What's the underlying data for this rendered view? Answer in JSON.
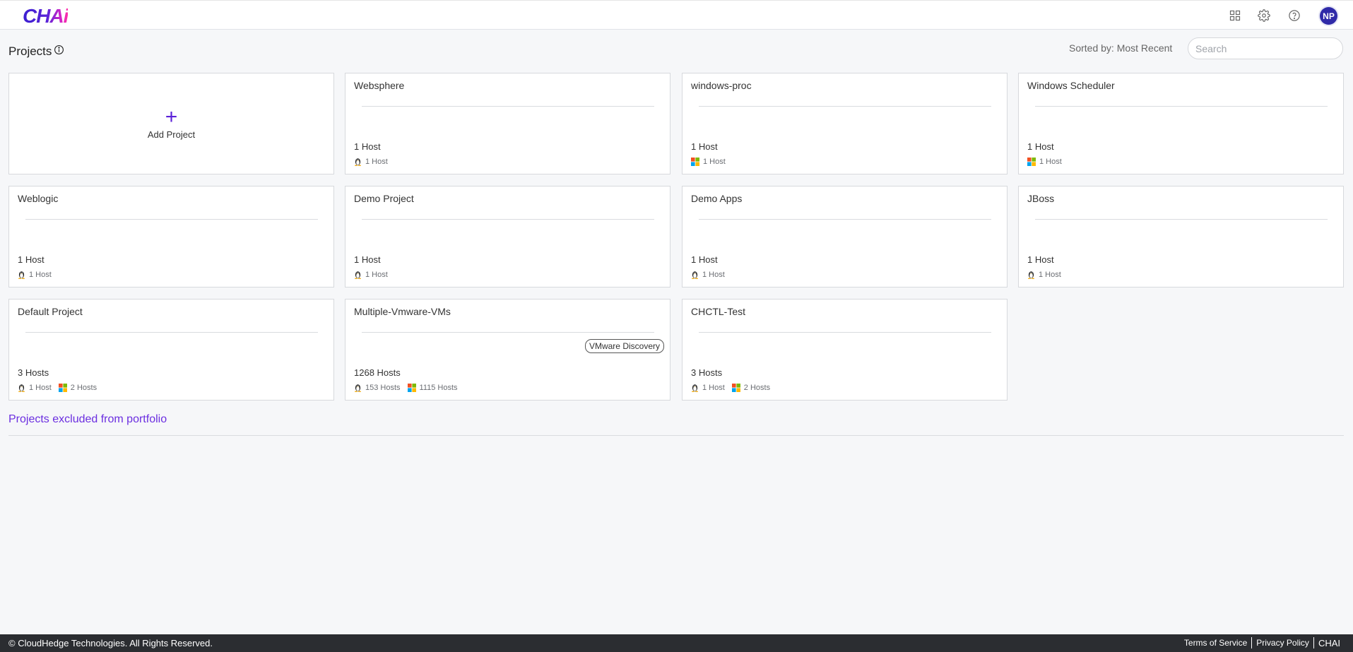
{
  "header": {
    "logo": "CHAi",
    "user_initials": "NP"
  },
  "page": {
    "title": "Projects",
    "sorted_by": "Sorted by: Most Recent",
    "search_placeholder": "Search"
  },
  "add_project_label": "Add Project",
  "projects": [
    {
      "name": "Websphere",
      "hosts": "1 Host",
      "os": [
        {
          "type": "linux-icon",
          "label": "1 Host"
        }
      ]
    },
    {
      "name": "windows-proc",
      "hosts": "1 Host",
      "os": [
        {
          "type": "windows-icon",
          "label": "1 Host"
        }
      ]
    },
    {
      "name": "Windows Scheduler",
      "hosts": "1 Host",
      "os": [
        {
          "type": "windows-icon",
          "label": "1 Host"
        }
      ]
    },
    {
      "name": "Weblogic",
      "hosts": "1 Host",
      "os": [
        {
          "type": "linux-icon",
          "label": "1 Host"
        }
      ]
    },
    {
      "name": "Demo Project",
      "hosts": "1 Host",
      "os": [
        {
          "type": "linux-icon",
          "label": "1 Host"
        }
      ]
    },
    {
      "name": "Demo Apps",
      "hosts": "1 Host",
      "os": [
        {
          "type": "linux-icon",
          "label": "1 Host"
        }
      ]
    },
    {
      "name": "JBoss",
      "hosts": "1 Host",
      "os": [
        {
          "type": "linux-icon",
          "label": "1 Host"
        }
      ]
    },
    {
      "name": "Default Project",
      "hosts": "3 Hosts",
      "os": [
        {
          "type": "linux-icon",
          "label": "1 Host"
        },
        {
          "type": "windows-icon",
          "label": "2 Hosts"
        }
      ]
    },
    {
      "name": "Multiple-Vmware-VMs",
      "hosts": "1268 Hosts",
      "badge": "VMware Discovery",
      "os": [
        {
          "type": "linux-icon",
          "label": "153 Hosts"
        },
        {
          "type": "windows-icon",
          "label": "1115 Hosts"
        }
      ]
    },
    {
      "name": "CHCTL-Test",
      "hosts": "3 Hosts",
      "os": [
        {
          "type": "linux-icon",
          "label": "1 Host"
        },
        {
          "type": "windows-icon",
          "label": "2 Hosts"
        }
      ]
    }
  ],
  "excluded_link": "Projects excluded from portfolio",
  "footer": {
    "copyright": "© CloudHedge Technologies. All Rights Reserved.",
    "terms": "Terms of Service",
    "privacy": "Privacy Policy",
    "brand": "CHAI"
  },
  "colors": {
    "accent": "#5b21d8",
    "avatar": "#2f2aa8",
    "footer_bg": "#2b2d31"
  }
}
